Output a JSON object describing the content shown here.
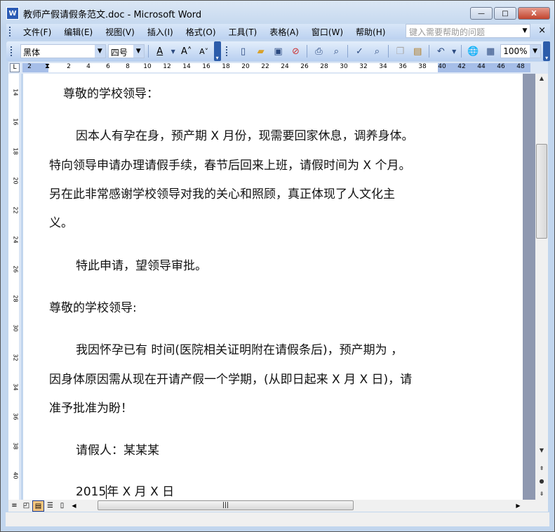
{
  "window": {
    "title": "教师产假请假条范文.doc - Microsoft Word",
    "app_icon": "W",
    "buttons": {
      "minimize": "—",
      "maximize": "□",
      "close": "X"
    }
  },
  "menu": {
    "items": [
      "文件(F)",
      "编辑(E)",
      "视图(V)",
      "插入(I)",
      "格式(O)",
      "工具(T)",
      "表格(A)",
      "窗口(W)",
      "帮助(H)"
    ],
    "help_placeholder": "键入需要帮助的问题",
    "close": "×"
  },
  "toolbar": {
    "font": "黑体",
    "size": "四号",
    "zoom": "100%",
    "icons": [
      "font-color",
      "grow-font",
      "shrink-font",
      "new",
      "open",
      "save",
      "permission",
      "print",
      "print-preview",
      "spelling",
      "research",
      "copy",
      "paste",
      "undo",
      "hyperlink",
      "table"
    ]
  },
  "ruler": {
    "left_label": "2",
    "ticks": [
      "2",
      "4",
      "6",
      "8",
      "10",
      "12",
      "14",
      "16",
      "18",
      "20",
      "22",
      "24",
      "26",
      "28",
      "30",
      "32",
      "34",
      "36",
      "38",
      "40",
      "42",
      "44",
      "46",
      "48"
    ],
    "vticks": [
      "14",
      "16",
      "18",
      "20",
      "22",
      "24",
      "26",
      "28",
      "30",
      "32",
      "34",
      "36",
      "38",
      "40"
    ]
  },
  "document": {
    "lines": [
      "尊敬的学校领导：",
      "因本人有孕在身，预产期 X 月份，现需要回家休息，调养身体。",
      "特向领导申请办理请假手续，春节后回来上班，请假时间为 X 个月。",
      "另在此非常感谢学校领导对我的关心和照顾，真正体现了人文化主",
      "义。",
      "特此申请，望领导审批。",
      "尊敬的学校领导:",
      "我因怀孕已有 时间(医院相关证明附在请假条后)，预产期为 ，",
      "因身体原因需从现在开请产假一个学期，(从即日起来 X 月 X 日)，请",
      "准予批准为盼！",
      "请假人：某某某"
    ],
    "date_year": "2015",
    "date_rest": "年 X 月 X 日"
  }
}
